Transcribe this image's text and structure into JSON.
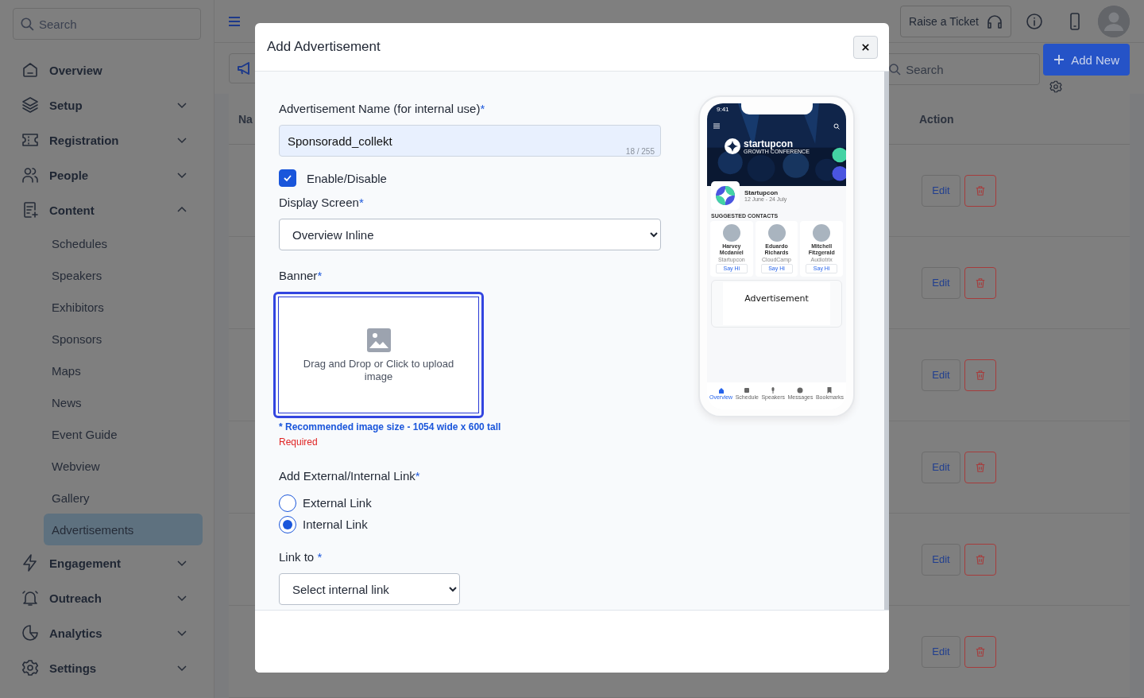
{
  "sidebar": {
    "search_placeholder": "Search",
    "items": [
      {
        "label": "Overview"
      },
      {
        "label": "Setup",
        "expanded": false
      },
      {
        "label": "Registration",
        "expanded": false
      },
      {
        "label": "People",
        "expanded": false
      },
      {
        "label": "Content",
        "expanded": true,
        "children": [
          {
            "label": "Schedules",
            "selected": false
          },
          {
            "label": "Speakers",
            "selected": false
          },
          {
            "label": "Exhibitors",
            "selected": false
          },
          {
            "label": "Sponsors",
            "selected": false
          },
          {
            "label": "Maps",
            "selected": false
          },
          {
            "label": "News",
            "selected": false
          },
          {
            "label": "Event Guide",
            "selected": false
          },
          {
            "label": "Webview",
            "selected": false
          },
          {
            "label": "Gallery",
            "selected": false
          },
          {
            "label": "Advertisements",
            "selected": true
          }
        ]
      },
      {
        "label": "Engagement",
        "expanded": false
      },
      {
        "label": "Outreach",
        "expanded": false
      },
      {
        "label": "Analytics",
        "expanded": false
      },
      {
        "label": "Settings",
        "expanded": false
      }
    ]
  },
  "header": {
    "ticket_button": "Raise a Ticket"
  },
  "toolbar": {
    "search_placeholder": "Search",
    "add_button": "Add New"
  },
  "table": {
    "columns": [
      "Na",
      "Action"
    ],
    "rows": [
      {
        "edit": "Edit"
      },
      {
        "edit": "Edit"
      },
      {
        "edit": "Edit"
      },
      {
        "edit": "Edit"
      },
      {
        "edit": "Edit"
      },
      {
        "edit": "Edit"
      }
    ]
  },
  "modal": {
    "title": "Add Advertisement",
    "form": {
      "name": {
        "label": "Advertisement Name (for internal use)",
        "required_mark": "*",
        "value": "Sponsoradd_collekt",
        "counter": "18 / 255"
      },
      "enable": {
        "label": "Enable/Disable",
        "checked": true
      },
      "display_screen": {
        "label": "Display Screen",
        "required_mark": "*",
        "value": "Overview Inline"
      },
      "banner": {
        "label": "Banner",
        "required_mark": "*",
        "upload_hint": "Drag and Drop or Click to upload image",
        "size_hint": "* Recommended image size - 1054 wide x 600 tall",
        "error": "Required"
      },
      "link_type": {
        "label": "Add External/Internal Link",
        "required_mark": "*",
        "options": [
          {
            "label": "External Link",
            "selected": false
          },
          {
            "label": "Internal Link",
            "selected": true
          }
        ]
      },
      "link_to": {
        "label": "Link to ",
        "required_mark": "*",
        "value": "Select internal link"
      }
    },
    "preview": {
      "time": "9:41",
      "brand": "startupcon",
      "tagline": "GROWTH CONFERENCE",
      "event_name": "Startupcon",
      "event_dates": "12 June - 24 July",
      "section_title": "SUGGESTED CONTACTS",
      "contacts": [
        {
          "name": "Harvey Mcdaniel",
          "company": "Startupcon",
          "action": "Say Hi"
        },
        {
          "name": "Eduardo Richards",
          "company": "CloudCamp",
          "action": "Say Hi"
        },
        {
          "name": "Mitchell Fitzgerald",
          "company": "Audiotrix",
          "action": "Say Hi"
        }
      ],
      "ad_label": "Advertisement",
      "nav": [
        {
          "label": "Overview",
          "selected": true
        },
        {
          "label": "Schedule",
          "selected": false
        },
        {
          "label": "Speakers",
          "selected": false
        },
        {
          "label": "Messages",
          "selected": false
        },
        {
          "label": "Bookmarks",
          "selected": false
        }
      ]
    }
  }
}
